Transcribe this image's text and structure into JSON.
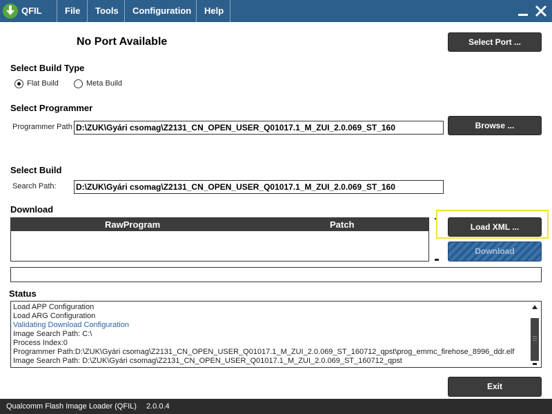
{
  "app": {
    "name": "QFIL",
    "menus": [
      "File",
      "Tools",
      "Configuration",
      "Help"
    ]
  },
  "port": {
    "status": "No Port Available",
    "select_port_label": "Select Port ..."
  },
  "build_type": {
    "heading": "Select Build Type",
    "options": [
      {
        "label": "Flat Build",
        "selected": true
      },
      {
        "label": "Meta Build",
        "selected": false
      }
    ]
  },
  "programmer": {
    "heading": "Select Programmer",
    "path_label": "Programmer Path",
    "path_value": "D:\\ZUK\\Gyári csomag\\Z2131_CN_OPEN_USER_Q01017.1_M_ZUI_2.0.069_ST_160",
    "browse_label": "Browse ..."
  },
  "build": {
    "heading": "Select Build",
    "search_label": "Search Path:",
    "search_value": "D:\\ZUK\\Gyári csomag\\Z2131_CN_OPEN_USER_Q01017.1_M_ZUI_2.0.069_ST_160"
  },
  "download": {
    "heading": "Download",
    "columns": [
      "RawProgram",
      "Patch"
    ],
    "load_xml_label": "Load XML ...",
    "download_label": "Download",
    "highlight_color": "#f2e334"
  },
  "status": {
    "heading": "Status",
    "lines": [
      {
        "text": "Load APP Configuration",
        "color": "#222222"
      },
      {
        "text": "Load ARG Configuration",
        "color": "#222222"
      },
      {
        "text": "Validating Download Configuration",
        "color": "#2c62a0"
      },
      {
        "text": "Image Search Path: C:\\",
        "color": "#222222"
      },
      {
        "text": "Process Index:0",
        "color": "#222222"
      },
      {
        "text": "Programmer Path:D:\\ZUK\\Gyári csomag\\Z2131_CN_OPEN_USER_Q01017.1_M_ZUI_2.0.069_ST_160712_qpst\\prog_emmc_firehose_8996_ddr.elf",
        "color": "#222222"
      },
      {
        "text": "Image Search Path: D:\\ZUK\\Gyári csomag\\Z2131_CN_OPEN_USER_Q01017.1_M_ZUI_2.0.069_ST_160712_qpst",
        "color": "#222222"
      }
    ]
  },
  "exit_label": "Exit",
  "footer": {
    "product": "Qualcomm Flash Image Loader (QFIL)",
    "version": "2.0.0.4"
  },
  "colors": {
    "titlebar": "#2d5f8c",
    "button": "#3c3c3c",
    "download_button": "#2a5d92",
    "statusbar": "#2c2c2c"
  },
  "icons": {
    "logo": "download-arrow-icon",
    "minimize": "minimize-icon",
    "close": "close-icon",
    "radio": "radio-icon",
    "scroll_up": "scroll-up-arrow-icon",
    "scroll_down": "scroll-down-arrow-icon"
  }
}
